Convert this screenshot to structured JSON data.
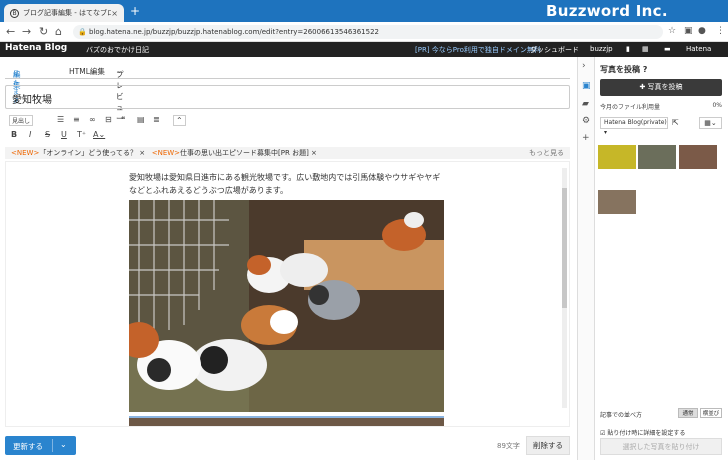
{
  "browser": {
    "tab_title": "ブログ記事編集 - はてなブログ",
    "url": "blog.hatena.ne.jp/buzzjp/buzzjp.hatenablog.com/edit?entry=26006613546361522",
    "brand": "Buzzword Inc."
  },
  "header": {
    "logo": "Hatena Blog",
    "blog_name": "バズのおでかけ日記",
    "promo": "[PR] 今ならPro利用で独自ドメイン無料",
    "dashboard": "ダッシュボード",
    "user": "buzzjp",
    "hatena": "Hatena"
  },
  "editor": {
    "tabs": [
      {
        "label": "編集",
        "sub": "見たまま"
      },
      {
        "label": "HTML編集"
      },
      {
        "label": "プレビュー"
      }
    ],
    "title": "愛知牧場",
    "style_select": "見出し",
    "news": [
      {
        "tag": "<NEW>",
        "text": "「オンライン」どう使ってる？"
      },
      {
        "tag": "<NEW>",
        "text": "仕事の思い出エピソード募集中[PR お題]"
      }
    ],
    "news_more": "もっと見る",
    "body_text": "愛知牧場は愛知県日進市にある観光牧場です。広い敷地内では引馬体験やウサギやヤギなどとふれあえるどうぶつ広場があります。",
    "update_button": "更新する",
    "char_count": "89文字",
    "delete_button": "削除する"
  },
  "sidebar": {
    "heading": "写真を投稿",
    "post_button": "写真を投稿",
    "usage_label": "今月のファイル利用量",
    "usage_value": "0%",
    "album": "Hatena Blog(private)",
    "sort_label": "記事での並べ方",
    "sort_options": [
      "通常",
      "横並び"
    ],
    "detail_setting": "貼り付け時に詳細を設定する",
    "paste_button": "選択した写真を貼り付け"
  },
  "colors": {
    "accent": "#2a84ce",
    "tabbar": "#1e73be",
    "header": "#222222",
    "news_tag": "#ee6600"
  }
}
